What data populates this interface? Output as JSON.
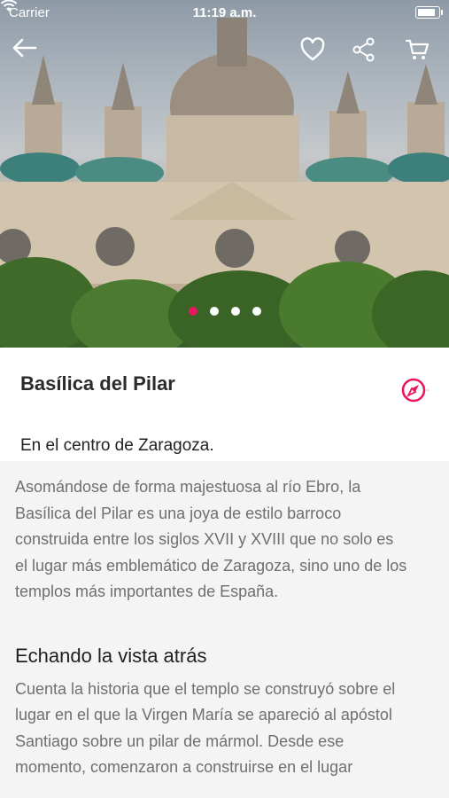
{
  "status_bar": {
    "carrier": "Carrier",
    "time": "11:19 a.m."
  },
  "toolbar": {
    "back_icon": "arrow-left-icon",
    "favorite_icon": "heart-icon",
    "share_icon": "share-icon",
    "cart_icon": "cart-icon"
  },
  "gallery": {
    "page_count": 4,
    "current_page": 1
  },
  "place": {
    "name": "Basílica del Pilar",
    "location": "En el centro de Zaragoza.",
    "map_icon": "compass-icon"
  },
  "description": {
    "intro_lines": [
      "Asomándose de forma majestuosa al río Ebro, la",
      "Basílica del Pilar es una joya de estilo barroco",
      "construida entre los siglos XVII y XVIII que no solo es",
      "el lugar más emblemático de Zaragoza, sino uno de los",
      "templos más importantes de España."
    ],
    "section_heading": "Echando la vista atrás",
    "section_lines": [
      "Cuenta la historia que el templo se construyó sobre el",
      "lugar en el que la Virgen María se apareció al apóstol",
      "Santiago sobre un pilar de mármol. Desde ese",
      "momento, comenzaron a construirse en el lugar"
    ]
  },
  "colors": {
    "accent": "#e5195c",
    "text": "#222222",
    "body_text": "#6f6f6f"
  }
}
